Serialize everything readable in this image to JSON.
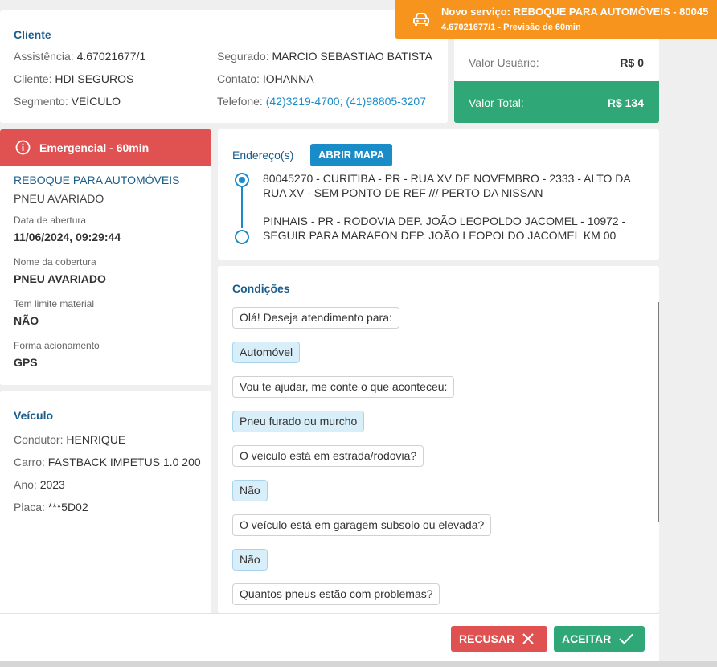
{
  "toast": {
    "icon": "car-icon",
    "title": "Novo serviço: REBOQUE PARA AUTOMÓVEIS - 80045",
    "subtitle": "4.67021677/1 - Previsão de 60min"
  },
  "client": {
    "title": "Cliente",
    "assistance_label": "Assistência:",
    "assistance_value": "4.67021677/1",
    "client_label": "Cliente:",
    "client_value": "HDI SEGUROS",
    "segment_label": "Segmento:",
    "segment_value": "VEÍCULO",
    "insured_label": "Segurado:",
    "insured_value": "MARCIO SEBASTIAO BATISTA",
    "contact_label": "Contato:",
    "contact_value": "IOHANNA",
    "phone_label": "Telefone:",
    "phone_value": "(42)3219-4700; (41)98805-3207"
  },
  "values": {
    "user_label": "Valor Usuário:",
    "user_value": "R$ 0",
    "total_label": "Valor Total:",
    "total_value": "R$ 134"
  },
  "service": {
    "urgency": "Emergencial - 60min",
    "name": "REBOQUE PARA AUTOMÓVEIS",
    "problem": "PNEU AVARIADO",
    "opening_label": "Data de abertura",
    "opening_value": "11/06/2024, 09:29:44",
    "coverage_label": "Nome da cobertura",
    "coverage_value": "PNEU AVARIADO",
    "limit_label": "Tem limite material",
    "limit_value": "NÃO",
    "trigger_label": "Forma acionamento",
    "trigger_value": "GPS"
  },
  "vehicle": {
    "title": "Veículo",
    "driver_label": "Condutor:",
    "driver_value": "HENRIQUE",
    "car_label": "Carro:",
    "car_value": "FASTBACK IMPETUS 1.0 200",
    "year_label": "Ano:",
    "year_value": "2023",
    "plate_label": "Placa:",
    "plate_value": "***5D02"
  },
  "address": {
    "title": "Endereço(s)",
    "map_button": "ABRIR MAPA",
    "origin": "80045270 - CURITIBA - PR - RUA XV DE NOVEMBRO - 2333 - ALTO DA RUA XV - SEM PONTO DE REF /// PERTO DA NISSAN",
    "destination": "PINHAIS - PR - RODOVIA DEP. JOÃO LEOPOLDO JACOMEL - 10972 - SEGUIR PARA MARAFON DEP. JOÃO LEOPOLDO JACOMEL KM 00"
  },
  "conditions": {
    "title": "Condições",
    "messages": [
      {
        "text": "Olá! Deseja atendimento para:",
        "answer": false
      },
      {
        "text": "Automóvel",
        "answer": true
      },
      {
        "text": "Vou te ajudar, me conte o que aconteceu:",
        "answer": false
      },
      {
        "text": "Pneu furado ou murcho",
        "answer": true
      },
      {
        "text": "O veiculo está em estrada/rodovia?",
        "answer": false
      },
      {
        "text": "Não",
        "answer": true
      },
      {
        "text": "O veículo está em garagem subsolo ou elevada?",
        "answer": false
      },
      {
        "text": "Não",
        "answer": true
      },
      {
        "text": "Quantos pneus estão com problemas?",
        "answer": false
      }
    ]
  },
  "actions": {
    "reject_label": "RECUSAR",
    "accept_label": "ACEITAR"
  }
}
